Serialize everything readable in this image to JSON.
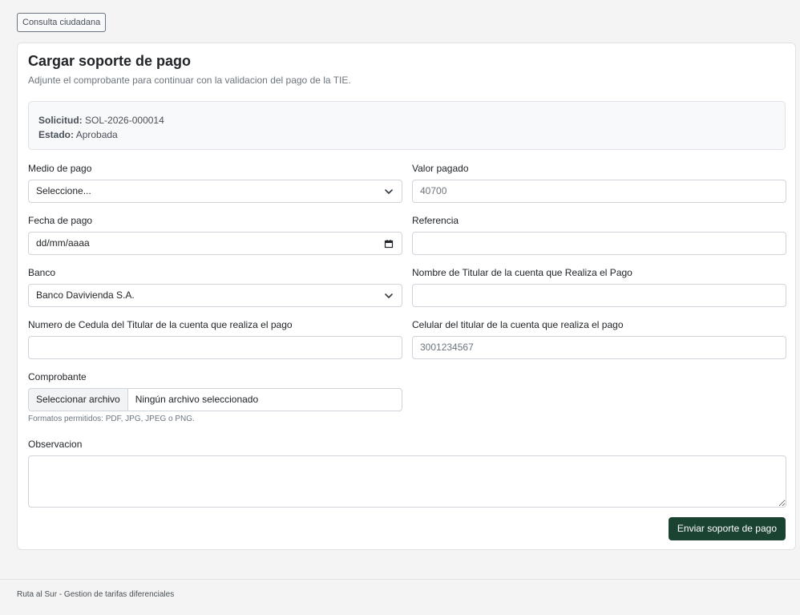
{
  "nav": {
    "consulta_label": "Consulta ciudadana"
  },
  "card": {
    "title": "Cargar soporte de pago",
    "subtitle": "Adjunte el comprobante para continuar con la validacion del pago de la TIE."
  },
  "summary": {
    "solicitud_label": "Solicitud:",
    "solicitud_value": "SOL-2026-000014",
    "estado_label": "Estado:",
    "estado_value": "Aprobada"
  },
  "form": {
    "medio_pago": {
      "label": "Medio de pago",
      "value": "Seleccione..."
    },
    "valor_pagado": {
      "label": "Valor pagado",
      "value": "40700"
    },
    "fecha_pago": {
      "label": "Fecha de pago",
      "value": "dd/mm/aaaa"
    },
    "referencia": {
      "label": "Referencia",
      "value": ""
    },
    "banco": {
      "label": "Banco",
      "value": "Banco Davivienda S.A."
    },
    "nombre_titular": {
      "label": "Nombre de Titular de la cuenta que Realiza el Pago",
      "value": ""
    },
    "cedula_titular": {
      "label": "Numero de Cedula del Titular de la cuenta que realiza el pago",
      "value": ""
    },
    "celular_titular": {
      "label": "Celular del titular de la cuenta que realiza el pago",
      "value": "3001234567"
    },
    "comprobante": {
      "label": "Comprobante",
      "button_label": "Seleccionar archivo",
      "file_status": "Ningún archivo seleccionado",
      "help": "Formatos permitidos: PDF, JPG, JPEG o PNG."
    },
    "observacion": {
      "label": "Observacion",
      "value": ""
    },
    "submit_label": "Enviar soporte de pago"
  },
  "footer": {
    "text": "Ruta al Sur - Gestion de tarifas diferenciales"
  },
  "colors": {
    "primary_button": "#1b4332",
    "background": "#f3f4f3"
  },
  "icons": {
    "select": "chevron-down-icon",
    "date": "calendar-icon",
    "textarea": "resize-handle-icon"
  }
}
